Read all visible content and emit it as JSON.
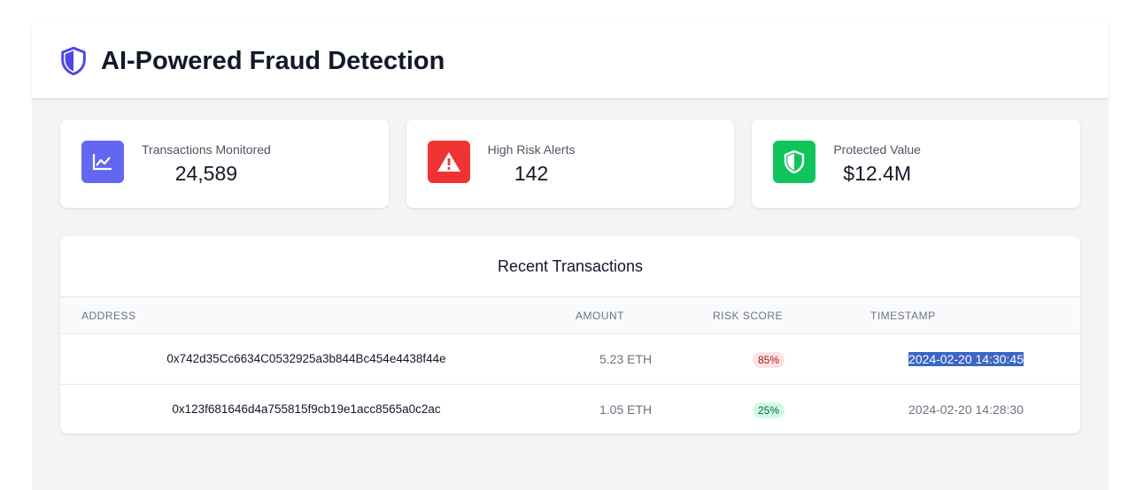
{
  "header": {
    "title": "AI-Powered Fraud Detection",
    "icon": "shield-icon"
  },
  "stats": [
    {
      "label": "Transactions Monitored",
      "value": "24,589",
      "icon": "trending-chart-icon",
      "color": "#6366f1"
    },
    {
      "label": "High Risk Alerts",
      "value": "142",
      "icon": "warning-triangle-icon",
      "color": "#ef3333"
    },
    {
      "label": "Protected Value",
      "value": "$12.4M",
      "icon": "shield-icon",
      "color": "#10c45c"
    }
  ],
  "transactions": {
    "title": "Recent Transactions",
    "columns": [
      "ADDRESS",
      "AMOUNT",
      "RISK SCORE",
      "TIMESTAMP"
    ],
    "rows": [
      {
        "address": "0x742d35Cc6634C0532925a3b844Bc454e4438f44e",
        "amount": "5.23 ETH",
        "risk": "85%",
        "risk_level": "high",
        "timestamp": "2024-02-20 14:30:45"
      },
      {
        "address": "0x123f681646d4a755815f9cb19e1acc8565a0c2ac",
        "amount": "1.05 ETH",
        "risk": "25%",
        "risk_level": "low",
        "timestamp": "2024-02-20 14:28:30"
      }
    ]
  }
}
